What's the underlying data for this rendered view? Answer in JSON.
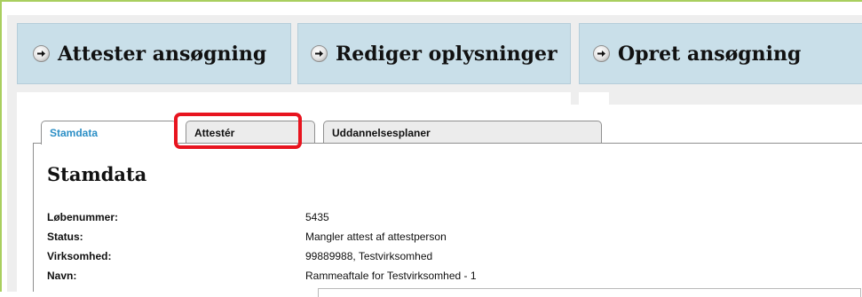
{
  "nav": {
    "items": [
      {
        "label": "Attester ansøgning"
      },
      {
        "label": "Rediger oplysninger"
      },
      {
        "label": "Opret ansøgning"
      }
    ]
  },
  "tabs": [
    {
      "label": "Stamdata",
      "active": true
    },
    {
      "label": "Attestér",
      "active": false
    },
    {
      "label": "Uddannelsesplaner",
      "active": false
    }
  ],
  "content": {
    "title": "Stamdata",
    "fields": [
      {
        "label": "Løbenummer:",
        "value": "5435"
      },
      {
        "label": "Status:",
        "value": "Mangler attest af attestperson"
      },
      {
        "label": "Virksomhed:",
        "value": "99889988, Testvirksomhed"
      },
      {
        "label": "Navn:",
        "value": "Rammeaftale for Testvirksomhed - 1"
      }
    ]
  },
  "colors": {
    "frame_border": "#a9cf5f",
    "nav_button_bg": "#c9dfe9",
    "active_tab_text": "#2c8fc6",
    "highlight": "#e8141f"
  },
  "icons": {
    "nav_icon": "arrow-right-circle-icon"
  }
}
